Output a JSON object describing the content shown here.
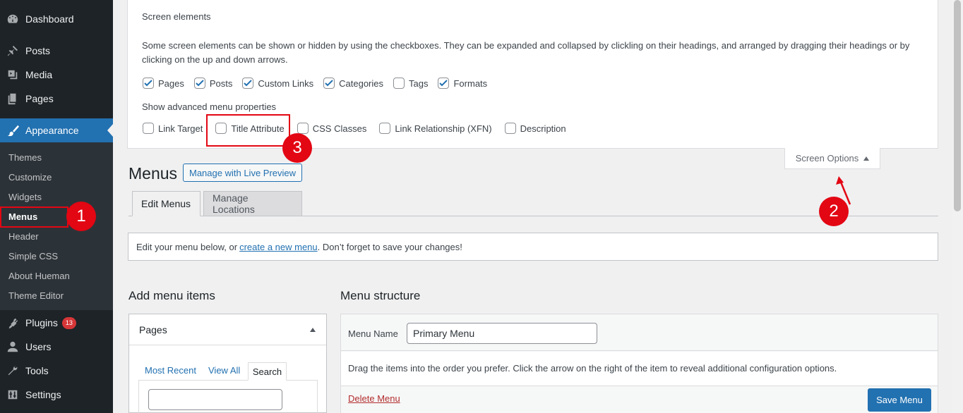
{
  "sidebar": {
    "items": [
      {
        "label": "Dashboard",
        "icon": "dashboard-icon"
      },
      {
        "label": "Posts",
        "icon": "pin-icon"
      },
      {
        "label": "Media",
        "icon": "media-icon"
      },
      {
        "label": "Pages",
        "icon": "pages-icon"
      },
      {
        "label": "Appearance",
        "icon": "brush-icon"
      },
      {
        "label": "Plugins",
        "icon": "plugin-icon",
        "badge": "13"
      },
      {
        "label": "Users",
        "icon": "user-icon"
      },
      {
        "label": "Tools",
        "icon": "wrench-icon"
      },
      {
        "label": "Settings",
        "icon": "settings-icon"
      }
    ],
    "submenu": [
      "Themes",
      "Customize",
      "Widgets",
      "Menus",
      "Header",
      "Simple CSS",
      "About Hueman",
      "Theme Editor"
    ]
  },
  "screen_options": {
    "heading": "Screen elements",
    "description": "Some screen elements can be shown or hidden by using the checkboxes. They can be expanded and collapsed by clickling on their headings, and arranged by dragging their headings or by clicking on the up and down arrows.",
    "elements": [
      {
        "label": "Pages",
        "checked": true
      },
      {
        "label": "Posts",
        "checked": true
      },
      {
        "label": "Custom Links",
        "checked": true
      },
      {
        "label": "Categories",
        "checked": true
      },
      {
        "label": "Tags",
        "checked": false
      },
      {
        "label": "Formats",
        "checked": true
      }
    ],
    "advanced_heading": "Show advanced menu properties",
    "advanced": [
      {
        "label": "Link Target",
        "checked": false
      },
      {
        "label": "Title Attribute",
        "checked": false
      },
      {
        "label": "CSS Classes",
        "checked": false
      },
      {
        "label": "Link Relationship (XFN)",
        "checked": false
      },
      {
        "label": "Description",
        "checked": false
      }
    ],
    "tab_label": "Screen Options"
  },
  "page": {
    "title": "Menus",
    "live_preview": "Manage with Live Preview",
    "tabs": [
      "Edit Menus",
      "Manage Locations"
    ],
    "notice_before": "Edit your menu below, or",
    "notice_link": "create a new menu",
    "notice_after": ". Don’t forget to save your changes!"
  },
  "add_items": {
    "heading": "Add menu items",
    "box_title": "Pages",
    "tabs": [
      "Most Recent",
      "View All",
      "Search"
    ]
  },
  "menu_structure": {
    "heading": "Menu structure",
    "name_label": "Menu Name",
    "name_value": "Primary Menu",
    "instructions": "Drag the items into the order you prefer. Click the arrow on the right of the item to reveal additional configuration options.",
    "delete_label": "Delete Menu",
    "save_label": "Save Menu"
  },
  "annotations": {
    "one": "1",
    "two": "2",
    "three": "3"
  },
  "colors": {
    "accent": "#2271b1",
    "annotation": "#e30613",
    "sidebar": "#1d2327"
  }
}
